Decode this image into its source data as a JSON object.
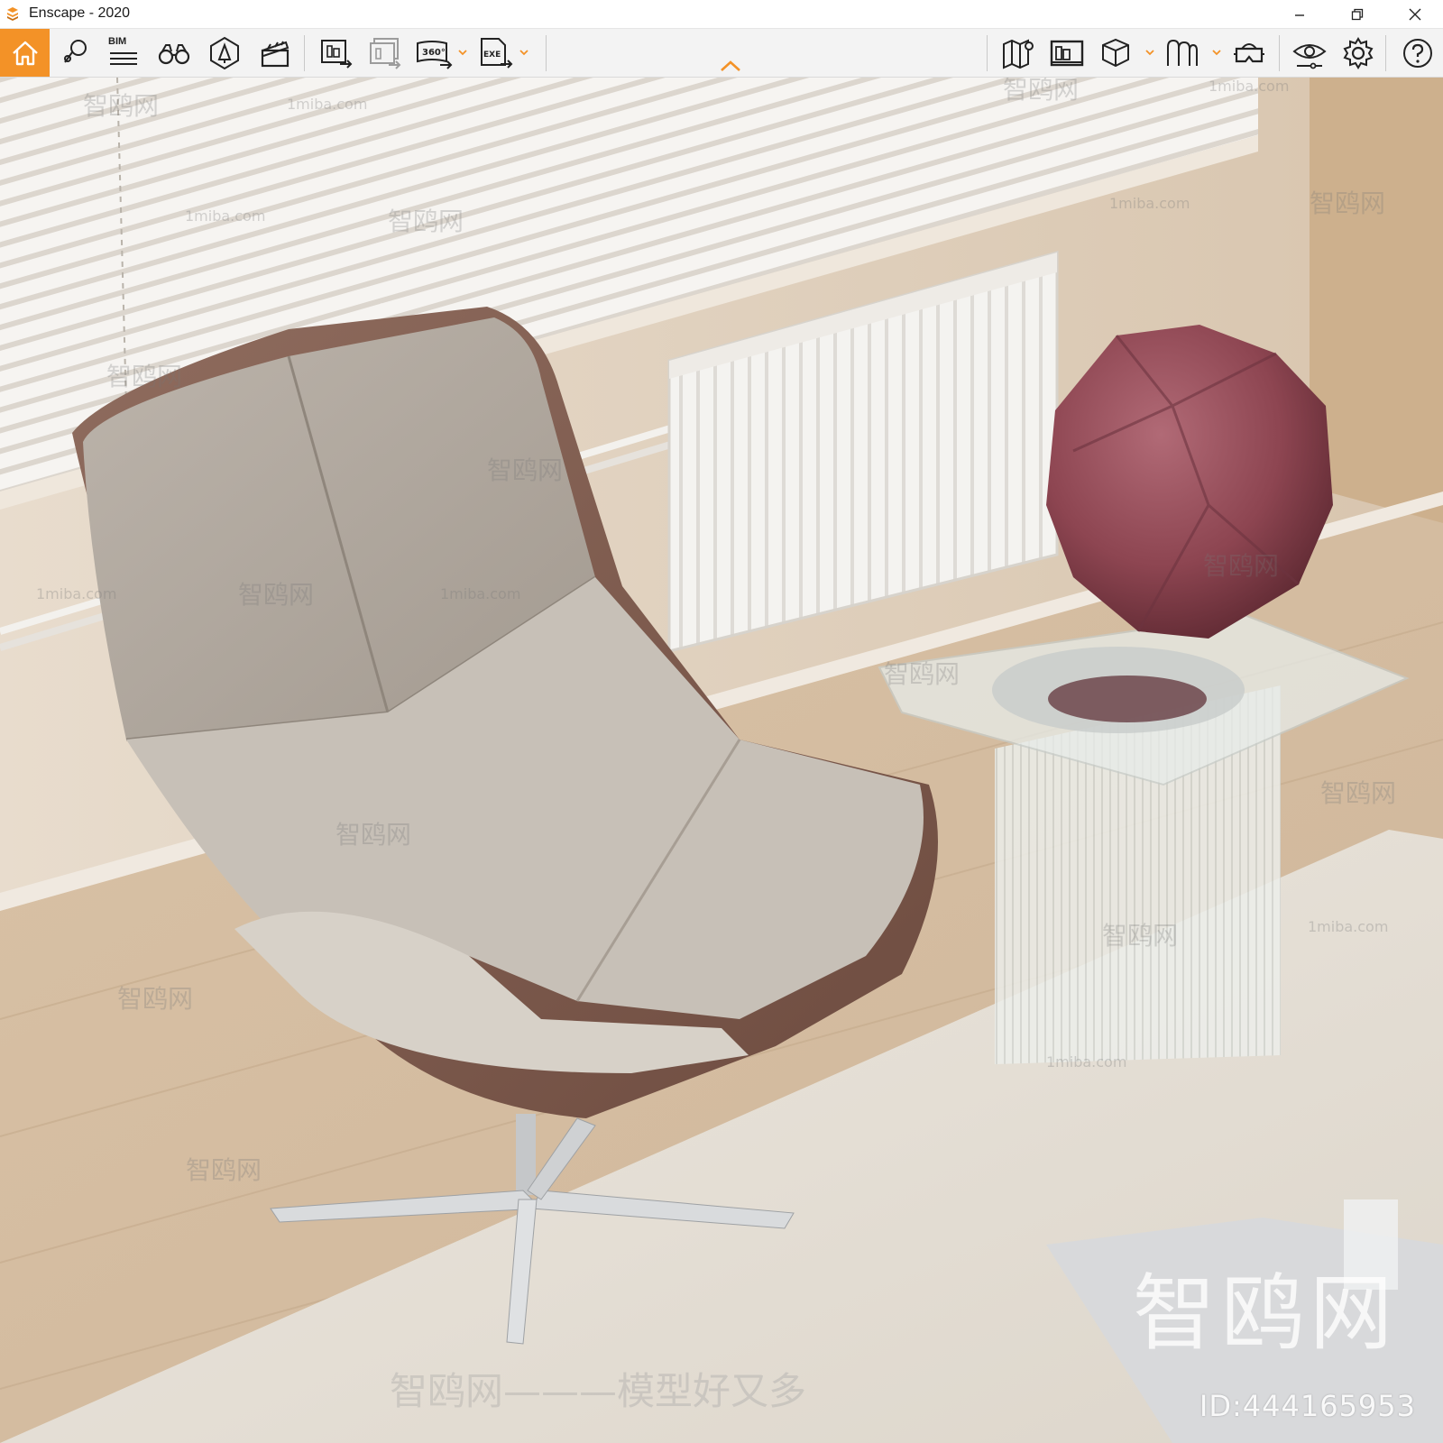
{
  "window": {
    "title": "Enscape - 2020",
    "app_icon": "enscape-logo-icon",
    "controls": [
      "minimize-icon",
      "restore-icon",
      "close-icon"
    ]
  },
  "toolbar": {
    "accent_color": "#f39227",
    "bim_label": "BIM",
    "tools": [
      {
        "name": "home",
        "icon": "home-icon"
      },
      {
        "name": "views",
        "icon": "views-pin-icon"
      },
      {
        "name": "bim",
        "icon": "bim-list-icon"
      },
      {
        "name": "binoculars",
        "icon": "binoculars-icon"
      },
      {
        "name": "asset-library",
        "icon": "asset-library-icon"
      },
      {
        "name": "video-editor",
        "icon": "clapperboard-icon"
      },
      {
        "name": "render-image",
        "icon": "render-image-icon"
      },
      {
        "name": "batch-render",
        "icon": "batch-render-icon"
      },
      {
        "name": "panorama-360",
        "icon": "panorama-360-icon",
        "label": "360°"
      },
      {
        "name": "export-exe",
        "icon": "export-exe-icon",
        "label": "EXE"
      },
      {
        "name": "map",
        "icon": "map-icon"
      },
      {
        "name": "screenshot-capture",
        "icon": "capture-icon"
      },
      {
        "name": "cube-view",
        "icon": "cube-icon"
      },
      {
        "name": "material-editor",
        "icon": "material-icon"
      },
      {
        "name": "vr-headset",
        "icon": "vr-headset-icon"
      },
      {
        "name": "visual-settings",
        "icon": "eye-settings-icon"
      },
      {
        "name": "general-settings",
        "icon": "gear-icon"
      },
      {
        "name": "help",
        "icon": "help-icon"
      }
    ],
    "collapse_icon": "chevron-up-icon"
  },
  "viewport": {
    "watermarks": {
      "site": "1miba.com",
      "brand": "智鸥网",
      "slogan": "智鸥网———模型好又多",
      "big": "智鸥网",
      "id": "ID:444165953"
    }
  }
}
